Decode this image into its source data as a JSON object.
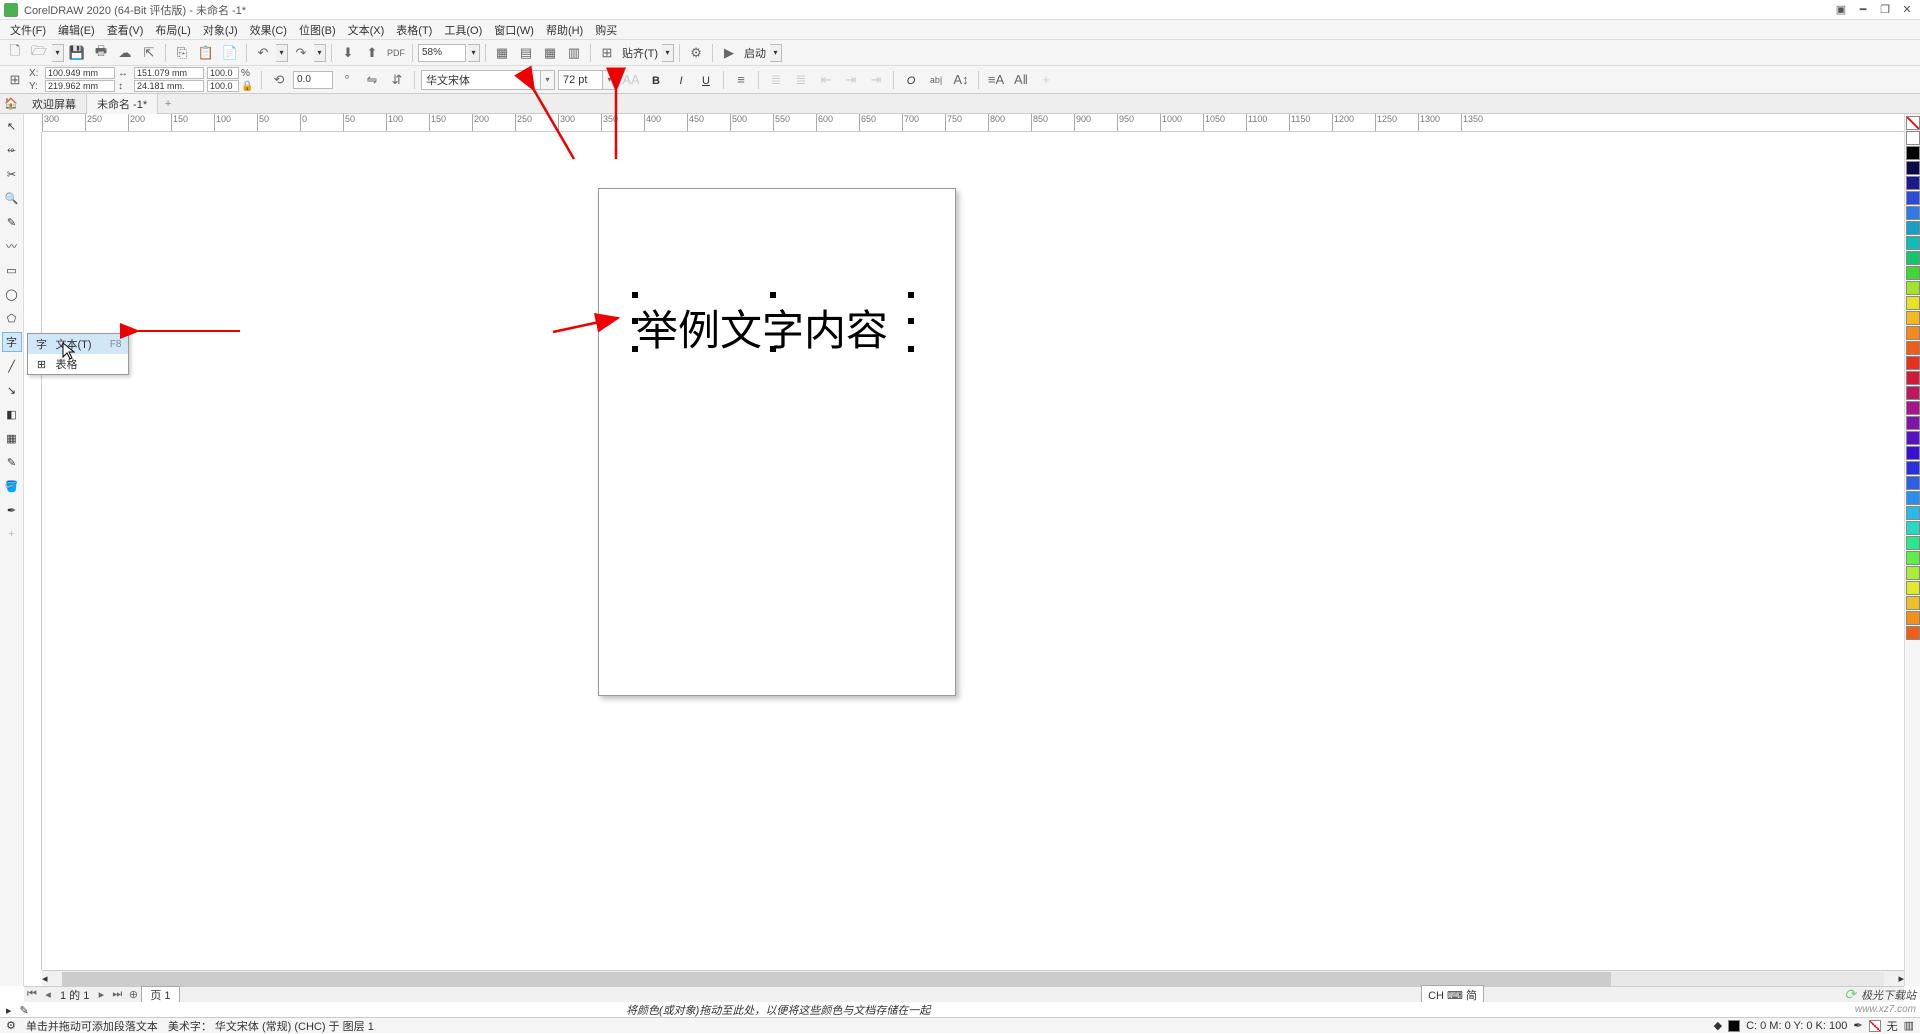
{
  "title": "CorelDRAW 2020 (64-Bit 评估版) - 未命名 -1*",
  "menu": [
    "文件(F)",
    "编辑(E)",
    "查看(V)",
    "布局(L)",
    "对象(J)",
    "效果(C)",
    "位图(B)",
    "文本(X)",
    "表格(T)",
    "工具(O)",
    "窗口(W)",
    "帮助(H)",
    "购买"
  ],
  "toolbar1": {
    "zoom": "58%",
    "snap": "贴齐(T)",
    "launch": "启动"
  },
  "prop": {
    "x": "100.949 mm",
    "y": "219.962 mm",
    "w": "151.079 mm",
    "h": "24.181 mm.",
    "sx": "100.0",
    "sy": "100.0",
    "angle": "0.0",
    "font": "华文宋体",
    "size": "72 pt"
  },
  "tabs": {
    "welcome": "欢迎屏幕",
    "doc": "未命名 -1*"
  },
  "ruler_ticks": [
    "300",
    "250",
    "200",
    "150",
    "100",
    "50",
    "0",
    "50",
    "100",
    "150",
    "200",
    "250",
    "300",
    "350",
    "400",
    "450",
    "500",
    "550",
    "600",
    "650",
    "700",
    "750",
    "800",
    "850",
    "900",
    "950",
    "1000",
    "1050",
    "1100",
    "1150",
    "1200",
    "1250",
    "1300",
    "1350"
  ],
  "flyout": {
    "text_label": "文本(T)",
    "text_key": "F8",
    "table_label": "表格"
  },
  "canvas_text": "举例文字内容",
  "colors": [
    "#ffffff",
    "#000000",
    "#0a0a46",
    "#1a1a8e",
    "#2a4bd8",
    "#2e7be8",
    "#17a0c4",
    "#0fbdb8",
    "#16c46a",
    "#3fd837",
    "#a3e22e",
    "#e6e225",
    "#f5b823",
    "#f28a1e",
    "#ee5d1b",
    "#e8301a",
    "#d11a3a",
    "#bb1860",
    "#a4168a",
    "#7f14a8",
    "#5a12c0",
    "#3a10d0",
    "#2a30e0",
    "#2a60e8",
    "#2a90ee",
    "#2abaea",
    "#2ad8c0",
    "#2ae88a",
    "#60ec4a",
    "#a8ee3a",
    "#e0e830",
    "#f0c028",
    "#f09020",
    "#ee6018"
  ],
  "pagebar": {
    "pageof": "1 的 1",
    "pagetab": "页 1",
    "lang": "CH ⌨ 简"
  },
  "hint": {
    "dropcolor": "将颜色(或对象)拖动至此处，以便将这些颜色与文档存储在一起"
  },
  "status": {
    "tip": "单击并拖动可添加段落文本",
    "font": "美术字： 华文宋体 (常规) (CHC) 于 图层 1",
    "cmyk": "C: 0 M: 0 Y: 0 K: 100",
    "none": "无"
  },
  "watermark": {
    "main": "极光下载站",
    "sub": "www.xz7.com"
  }
}
